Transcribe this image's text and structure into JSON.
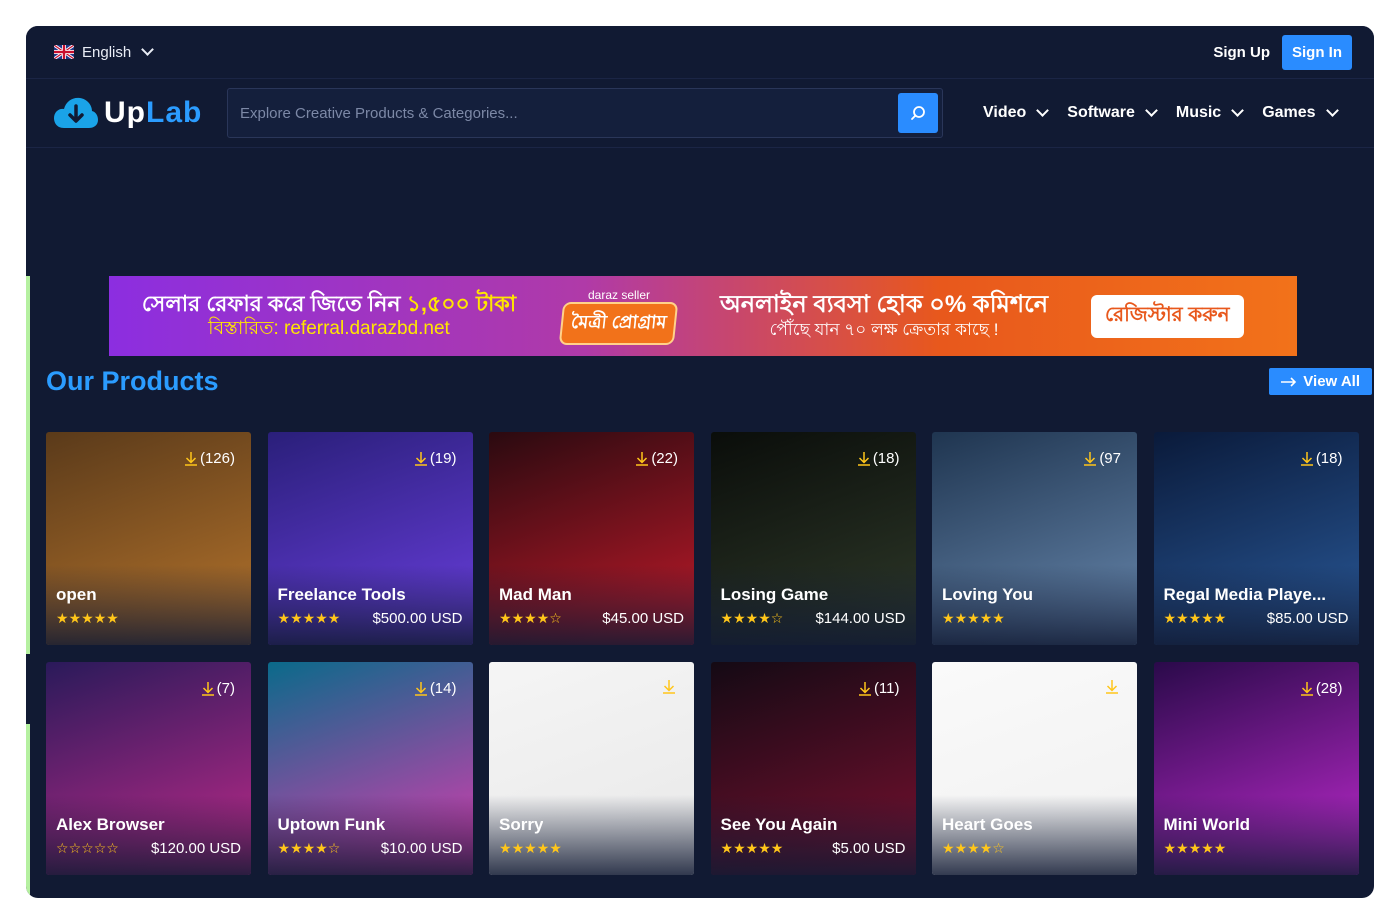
{
  "topbar": {
    "language": "English",
    "signup_label": "Sign Up",
    "signin_label": "Sign In"
  },
  "header": {
    "logo_up": "Up",
    "logo_lab": "Lab",
    "search_placeholder": "Explore Creative Products & Categories...",
    "nav": [
      "Video",
      "Software",
      "Music",
      "Games"
    ]
  },
  "banner": {
    "line1_a": "সেলার রেফার করে জিতে নিন",
    "line1_b": "১,৫০০ টাকা",
    "line2": "বিস্তারিত: referral.darazbd.net",
    "brand": "daraz seller",
    "program": "মৈত্রী প্রোগ্রাম",
    "headline": "অনলাইন ব্যবসা হোক ০% কমিশনে",
    "subline": "পৌঁছে যান ৭০ লক্ষ ক্রেতার কাছে !",
    "cta": "রেজিস্টার করুন"
  },
  "products": {
    "title": "Our Products",
    "view_all": "View All",
    "items": [
      {
        "title": "open",
        "downloads": "(126)",
        "rating": 5,
        "price": "",
        "colors": [
          "#5a3a1a",
          "#b7752c"
        ]
      },
      {
        "title": "Freelance Tools",
        "downloads": "(19)",
        "rating": 5,
        "price": "$500.00 USD",
        "colors": [
          "#2a1f7a",
          "#6b3fe0"
        ]
      },
      {
        "title": "Mad Man",
        "downloads": "(22)",
        "rating": 4,
        "price": "$45.00 USD",
        "colors": [
          "#2a0a10",
          "#c41a2a"
        ]
      },
      {
        "title": "Losing Game",
        "downloads": "(18)",
        "rating": 4,
        "price": "$144.00 USD",
        "colors": [
          "#0a0d0a",
          "#2f3a2a"
        ]
      },
      {
        "title": "Loving You",
        "downloads": "(97",
        "rating": 5,
        "price": "",
        "colors": [
          "#1f3550",
          "#6a8ab0"
        ]
      },
      {
        "title": "Regal Media Playe...",
        "downloads": "(18)",
        "rating": 5,
        "price": "$85.00 USD",
        "colors": [
          "#0a1a3a",
          "#2a5a9a"
        ]
      },
      {
        "title": "Alex Browser",
        "downloads": "(7)",
        "rating": 0,
        "price": "$120.00 USD",
        "colors": [
          "#2a1a5a",
          "#c02a8a"
        ]
      },
      {
        "title": "Uptown Funk",
        "downloads": "(14)",
        "rating": 4,
        "price": "$10.00 USD",
        "colors": [
          "#0a6a8a",
          "#e03ab0"
        ]
      },
      {
        "title": "Sorry",
        "downloads": "",
        "rating": 5,
        "price": "",
        "colors": [
          "#f5f5f5",
          "#e8e8e8"
        ]
      },
      {
        "title": "See You Again",
        "downloads": "(11)",
        "rating": 5,
        "price": "$5.00 USD",
        "colors": [
          "#140a14",
          "#7a1030"
        ]
      },
      {
        "title": "Heart Goes",
        "downloads": "",
        "rating": 4,
        "price": "",
        "colors": [
          "#fafafa",
          "#f0f0f0"
        ]
      },
      {
        "title": "Mini World",
        "downloads": "(28)",
        "rating": 5,
        "price": "",
        "colors": [
          "#2a0a4a",
          "#c02ad0"
        ]
      }
    ]
  }
}
